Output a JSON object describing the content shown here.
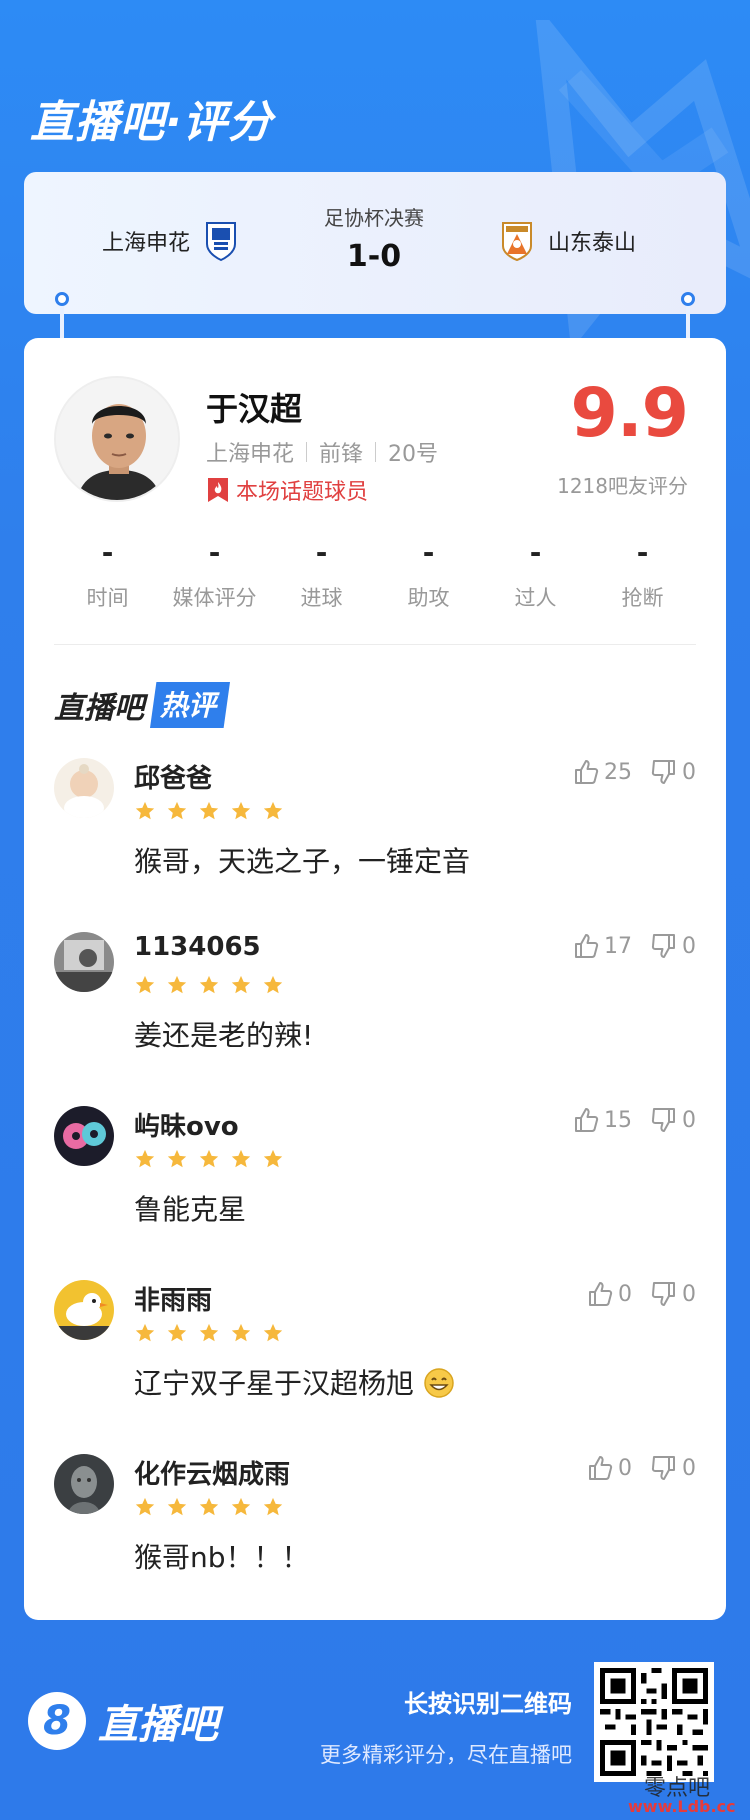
{
  "brand": {
    "title": "直播吧·评分"
  },
  "match": {
    "home_team": "上海申花",
    "away_team": "山东泰山",
    "competition": "足协杯决赛",
    "score": "1-0"
  },
  "player": {
    "name": "于汉超",
    "team": "上海申花",
    "position": "前锋",
    "number": "20号",
    "tag": "本场话题球员",
    "rating": "9.9",
    "rating_count": "1218吧友评分"
  },
  "stats": [
    {
      "label": "时间",
      "value": "-"
    },
    {
      "label": "媒体评分",
      "value": "-"
    },
    {
      "label": "进球",
      "value": "-"
    },
    {
      "label": "助攻",
      "value": "-"
    },
    {
      "label": "过人",
      "value": "-"
    },
    {
      "label": "抢断",
      "value": "-"
    }
  ],
  "hot_section": {
    "prefix": "直播吧",
    "badge": "热评"
  },
  "comments": [
    {
      "user": "邱爸爸",
      "stars": 5,
      "text": "猴哥，天选之子，一锤定音",
      "likes": "25",
      "dislikes": "0"
    },
    {
      "user": "1134065",
      "stars": 5,
      "text": "姜还是老的辣!",
      "likes": "17",
      "dislikes": "0"
    },
    {
      "user": "屿昧ovo",
      "stars": 5,
      "text": "鲁能克星",
      "likes": "15",
      "dislikes": "0"
    },
    {
      "user": "非雨雨",
      "stars": 5,
      "text": "辽宁双子星于汉超杨旭",
      "likes": "0",
      "dislikes": "0"
    },
    {
      "user": "化作云烟成雨",
      "stars": 5,
      "text": "猴哥nb！！！",
      "likes": "0",
      "dislikes": "0"
    }
  ],
  "footer": {
    "logo_mark": "8",
    "logo_text": "直播吧",
    "qr_title": "长按识别二维码",
    "qr_sub": "更多精彩评分，尽在直播吧"
  },
  "watermark": {
    "line1": "零点吧",
    "line2": "www.Ldb.cc"
  },
  "colors": {
    "primary": "#2f7fec",
    "rating": "#e94a3f",
    "star": "#f6b83c"
  }
}
